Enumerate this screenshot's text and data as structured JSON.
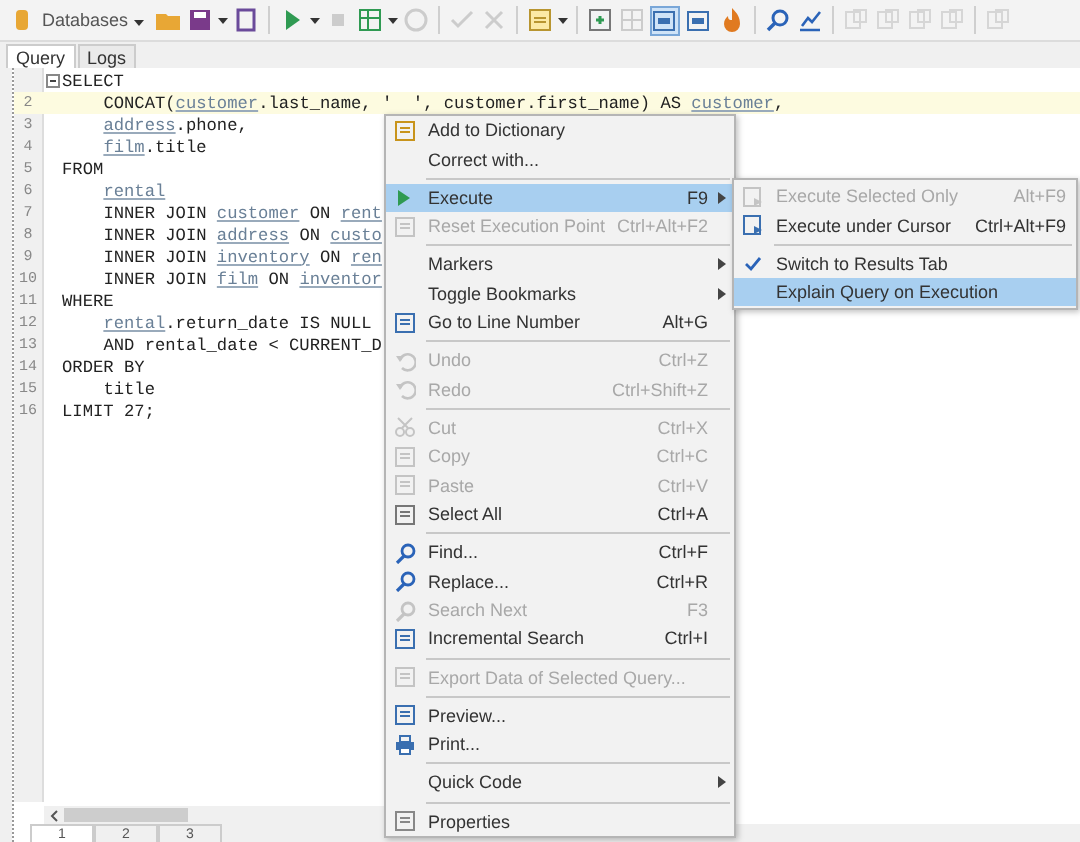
{
  "toolbar": {
    "database_label": "Databases",
    "toggles": [
      {
        "selected": true
      },
      {
        "selected": false
      }
    ]
  },
  "tabs": [
    {
      "label": "Query",
      "selected": true
    },
    {
      "label": "Logs",
      "selected": false
    }
  ],
  "editor": {
    "lines": [
      {
        "fold": true,
        "current": false,
        "indent": false,
        "tokens": [
          {
            "text": "SELECT",
            "kind": "kw"
          }
        ]
      },
      {
        "number": "2",
        "current": true,
        "indent": true,
        "tokens": [
          {
            "text": "CONCAT(",
            "kind": "kw"
          },
          {
            "text": "customer",
            "kind": "ident"
          },
          {
            "text": ".last_name, '  ', customer.first_name) AS ",
            "kind": "kw"
          },
          {
            "text": "customer",
            "kind": "ident"
          },
          {
            "text": ",",
            "kind": "kw"
          }
        ]
      },
      {
        "number": "3",
        "current": false,
        "indent": true,
        "tokens": [
          {
            "text": "address",
            "kind": "ident"
          },
          {
            "text": ".phone,",
            "kind": "kw"
          }
        ]
      },
      {
        "number": "4",
        "current": false,
        "indent": true,
        "tokens": [
          {
            "text": "film",
            "kind": "ident"
          },
          {
            "text": ".title",
            "kind": "kw"
          }
        ]
      },
      {
        "number": "5",
        "current": false,
        "indent": false,
        "tokens": [
          {
            "text": "FROM",
            "kind": "kw"
          }
        ]
      },
      {
        "number": "6",
        "current": false,
        "indent": true,
        "tokens": [
          {
            "text": "rental",
            "kind": "ident"
          }
        ]
      },
      {
        "number": "7",
        "current": false,
        "indent": true,
        "tokens": [
          {
            "text": "INNER JOIN ",
            "kind": "kw"
          },
          {
            "text": "customer",
            "kind": "ident"
          },
          {
            "text": " ON ",
            "kind": "kw"
          },
          {
            "text": "rent",
            "kind": "ident"
          }
        ]
      },
      {
        "number": "8",
        "current": false,
        "indent": true,
        "tokens": [
          {
            "text": "INNER JOIN ",
            "kind": "kw"
          },
          {
            "text": "address",
            "kind": "ident"
          },
          {
            "text": " ON ",
            "kind": "kw"
          },
          {
            "text": "custo",
            "kind": "ident"
          }
        ]
      },
      {
        "number": "9",
        "current": false,
        "indent": true,
        "tokens": [
          {
            "text": "INNER JOIN ",
            "kind": "kw"
          },
          {
            "text": "inventory",
            "kind": "ident"
          },
          {
            "text": " ON ",
            "kind": "kw"
          },
          {
            "text": "ren",
            "kind": "ident"
          }
        ]
      },
      {
        "number": "10",
        "current": false,
        "indent": true,
        "tokens": [
          {
            "text": "INNER JOIN ",
            "kind": "kw"
          },
          {
            "text": "film",
            "kind": "ident"
          },
          {
            "text": " ON ",
            "kind": "kw"
          },
          {
            "text": "inventor",
            "kind": "ident"
          }
        ]
      },
      {
        "number": "11",
        "current": false,
        "indent": false,
        "tokens": [
          {
            "text": "WHERE",
            "kind": "kw"
          }
        ]
      },
      {
        "number": "12",
        "current": false,
        "indent": true,
        "tokens": [
          {
            "text": "rental",
            "kind": "ident"
          },
          {
            "text": ".return_date IS NULL",
            "kind": "kw"
          }
        ]
      },
      {
        "number": "13",
        "current": false,
        "indent": true,
        "tokens": [
          {
            "text": "AND rental_date < CURRENT_D",
            "kind": "kw"
          }
        ]
      },
      {
        "number": "14",
        "current": false,
        "indent": false,
        "tokens": [
          {
            "text": "ORDER BY",
            "kind": "kw"
          }
        ]
      },
      {
        "number": "15",
        "current": false,
        "indent": true,
        "tokens": [
          {
            "text": "title",
            "kind": "kw"
          }
        ]
      },
      {
        "number": "16",
        "current": false,
        "indent": false,
        "tokens": [
          {
            "text": "LIMIT 27;",
            "kind": "kw"
          }
        ]
      }
    ]
  },
  "context_menu": [
    {
      "kind": "item",
      "label": "Add to Dictionary",
      "disabled": false,
      "selected": false
    },
    {
      "kind": "item",
      "label": "Correct with...",
      "disabled": false,
      "selected": false
    },
    {
      "kind": "separator"
    },
    {
      "kind": "item",
      "label": "Execute",
      "shortcut": "F9",
      "submenu": true,
      "disabled": false,
      "selected": true
    },
    {
      "kind": "item",
      "label": "Reset Execution Point",
      "shortcut": "Ctrl+Alt+F2",
      "disabled": true,
      "selected": false
    },
    {
      "kind": "separator"
    },
    {
      "kind": "item",
      "label": "Markers",
      "submenu": true,
      "disabled": false,
      "selected": false
    },
    {
      "kind": "item",
      "label": "Toggle Bookmarks",
      "submenu": true,
      "disabled": false,
      "selected": false
    },
    {
      "kind": "item",
      "label": "Go to Line Number",
      "shortcut": "Alt+G",
      "disabled": false,
      "selected": false
    },
    {
      "kind": "separator"
    },
    {
      "kind": "item",
      "label": "Undo",
      "shortcut": "Ctrl+Z",
      "disabled": true,
      "selected": false
    },
    {
      "kind": "item",
      "label": "Redo",
      "shortcut": "Ctrl+Shift+Z",
      "disabled": true,
      "selected": false
    },
    {
      "kind": "separator"
    },
    {
      "kind": "item",
      "label": "Cut",
      "shortcut": "Ctrl+X",
      "disabled": true,
      "selected": false
    },
    {
      "kind": "item",
      "label": "Copy",
      "shortcut": "Ctrl+C",
      "disabled": true,
      "selected": false
    },
    {
      "kind": "item",
      "label": "Paste",
      "shortcut": "Ctrl+V",
      "disabled": true,
      "selected": false
    },
    {
      "kind": "item",
      "label": "Select All",
      "shortcut": "Ctrl+A",
      "disabled": false,
      "selected": false
    },
    {
      "kind": "separator"
    },
    {
      "kind": "item",
      "label": "Find...",
      "shortcut": "Ctrl+F",
      "disabled": false,
      "selected": false
    },
    {
      "kind": "item",
      "label": "Replace...",
      "shortcut": "Ctrl+R",
      "disabled": false,
      "selected": false
    },
    {
      "kind": "item",
      "label": "Search Next",
      "shortcut": "F3",
      "disabled": true,
      "selected": false
    },
    {
      "kind": "item",
      "label": "Incremental Search",
      "shortcut": "Ctrl+I",
      "disabled": false,
      "selected": false
    },
    {
      "kind": "separator"
    },
    {
      "kind": "item",
      "label": "Export Data of Selected Query...",
      "disabled": true,
      "selected": false
    },
    {
      "kind": "separator"
    },
    {
      "kind": "item",
      "label": "Preview...",
      "disabled": false,
      "selected": false
    },
    {
      "kind": "item",
      "label": "Print...",
      "disabled": false,
      "selected": false
    },
    {
      "kind": "separator"
    },
    {
      "kind": "item",
      "label": "Quick Code",
      "submenu": true,
      "disabled": false,
      "selected": false
    },
    {
      "kind": "separator"
    },
    {
      "kind": "item",
      "label": "Properties",
      "disabled": false,
      "selected": false
    }
  ],
  "submenu": [
    {
      "kind": "item",
      "label": "Execute Selected Only",
      "shortcut": "Alt+F9",
      "disabled": true,
      "checked": false,
      "selected": false
    },
    {
      "kind": "item",
      "label": "Execute under Cursor",
      "shortcut": "Ctrl+Alt+F9",
      "disabled": false,
      "checked": false,
      "selected": false
    },
    {
      "kind": "separator"
    },
    {
      "kind": "item",
      "label": "Switch to Results Tab",
      "disabled": false,
      "checked": true,
      "selected": false
    },
    {
      "kind": "item",
      "label": "Explain Query on Execution",
      "disabled": false,
      "checked": false,
      "selected": true
    }
  ],
  "bottom_tabs": [
    {
      "label": "1",
      "selected": true
    },
    {
      "label": "2",
      "selected": false
    },
    {
      "label": "3",
      "selected": false
    }
  ]
}
